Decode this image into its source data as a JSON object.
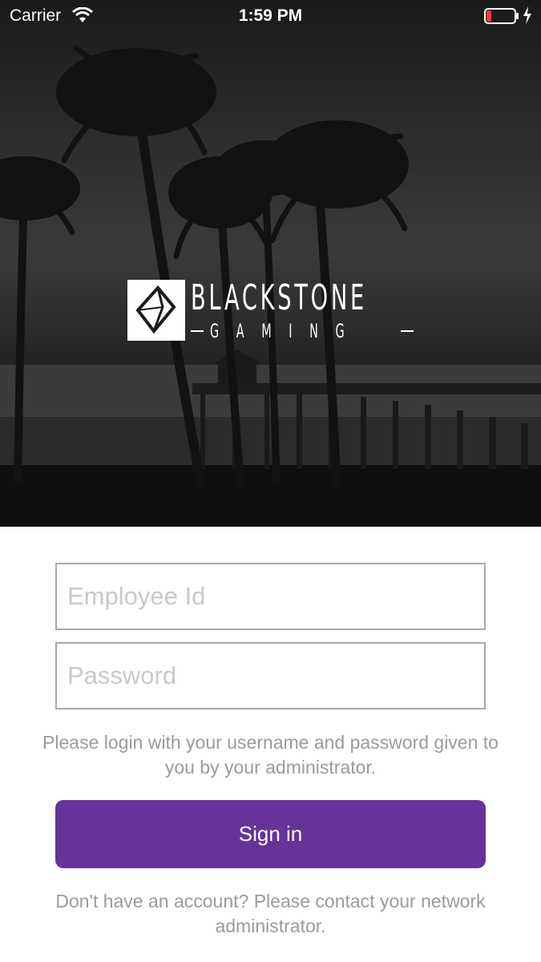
{
  "status_bar": {
    "carrier": "Carrier",
    "time": "1:59 PM",
    "battery_color": "#ff3b30"
  },
  "logo": {
    "title": "BLACKSTONE",
    "subtitle": "GAMING",
    "icon": "diamond-icon"
  },
  "form": {
    "employee_id": {
      "value": "",
      "placeholder": "Employee Id"
    },
    "password": {
      "value": "",
      "placeholder": "Password"
    },
    "help_text": "Please login with your username and password given to you by your administrator.",
    "sign_in_label": "Sign in",
    "footer_text": "Don't have an account? Please contact your network administrator."
  },
  "colors": {
    "accent": "#663399",
    "muted_text": "#9b9b9b",
    "input_border": "#a9a9a9"
  }
}
